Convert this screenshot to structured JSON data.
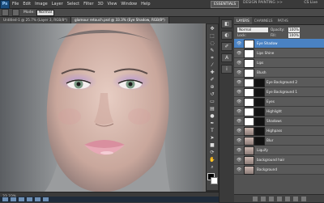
{
  "menubar": {
    "items": [
      "File",
      "Edit",
      "Image",
      "Layer",
      "Select",
      "Filter",
      "3D",
      "View",
      "Window",
      "Help"
    ],
    "workspace": "ESSENTIALS",
    "links": "DESIGN   PAINTING   >>",
    "live": "CS Live"
  },
  "options": {
    "mode_label": "Mode:",
    "mode_value": "Normal"
  },
  "tabs": [
    {
      "label": "Untitled-1 @ 25.7% (Layer 3, RGB/8*)",
      "active": false
    },
    {
      "label": "glamour retouch.psd @ 33.3% (Eye Shadow, RGB/8*)",
      "active": true
    }
  ],
  "status": {
    "zoom": "33.33%"
  },
  "panel": {
    "tabs": [
      "LAYERS",
      "CHANNELS",
      "PATHS"
    ],
    "blend_mode": "Normal",
    "opacity_label": "Opacity:",
    "opacity_value": "100%",
    "lock_label": "Lock:",
    "fill_label": "Fill:",
    "fill_value": "100%"
  },
  "layers": [
    {
      "name": "Eye Shadow",
      "active": true,
      "thumb": "white",
      "mask": false
    },
    {
      "name": "Lips Shine",
      "active": false,
      "thumb": "white",
      "mask": false
    },
    {
      "name": "Lips",
      "active": false,
      "thumb": "white",
      "mask": false
    },
    {
      "name": "Blush",
      "active": false,
      "thumb": "white",
      "mask": false
    },
    {
      "name": "Eye Background 2",
      "active": false,
      "thumb": "white",
      "mask": true
    },
    {
      "name": "Eye Background 1",
      "active": false,
      "thumb": "white",
      "mask": true
    },
    {
      "name": "Eyes",
      "active": false,
      "thumb": "white",
      "mask": true
    },
    {
      "name": "Highlight",
      "active": false,
      "thumb": "white",
      "mask": true
    },
    {
      "name": "Shadows",
      "active": false,
      "thumb": "white",
      "mask": true
    },
    {
      "name": "Highpass",
      "active": false,
      "thumb": "face",
      "mask": true
    },
    {
      "name": "Blur",
      "active": false,
      "thumb": "face",
      "mask": true
    },
    {
      "name": "Liquify",
      "active": false,
      "thumb": "face",
      "mask": false
    },
    {
      "name": "background hair",
      "active": false,
      "thumb": "face",
      "mask": false
    },
    {
      "name": "Background",
      "active": false,
      "thumb": "face",
      "mask": false
    }
  ],
  "toolbar": {
    "tools": [
      "move-tool",
      "marquee-tool",
      "lasso-tool",
      "quick-select-tool",
      "crop-tool",
      "eyedropper-tool",
      "healing-tool",
      "brush-tool",
      "clone-tool",
      "history-brush-tool",
      "eraser-tool",
      "gradient-tool",
      "dodge-tool",
      "pen-tool",
      "type-tool",
      "path-select-tool",
      "shape-tool",
      "3d-rotate-tool",
      "hand-tool",
      "zoom-tool"
    ]
  },
  "colors": {
    "accent": "#4a82c3",
    "panel": "#535353",
    "chrome": "#3a3a3a"
  }
}
